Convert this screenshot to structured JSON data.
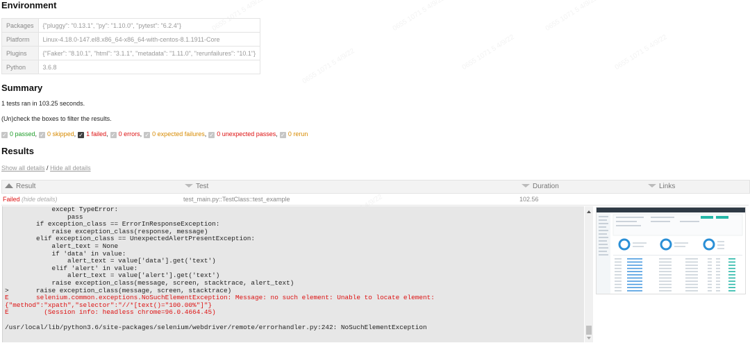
{
  "environment": {
    "heading": "Environment",
    "rows": [
      {
        "key": "Packages",
        "value": "{\"pluggy\": \"0.13.1\", \"py\": \"1.10.0\", \"pytest\": \"6.2.4\"}"
      },
      {
        "key": "Platform",
        "value": "Linux-4.18.0-147.el8.x86_64-x86_64-with-centos-8.1.1911-Core"
      },
      {
        "key": "Plugins",
        "value": "{\"Faker\": \"8.10.1\", \"html\": \"3.1.1\", \"metadata\": \"1.11.0\", \"rerunfailures\": \"10.1\"}"
      },
      {
        "key": "Python",
        "value": "3.6.8"
      }
    ]
  },
  "summary": {
    "heading": "Summary",
    "ran_text": "1 tests ran in 103.25 seconds.",
    "filter_hint": "(Un)check the boxes to filter the results.",
    "filters": [
      {
        "label": "0 passed",
        "checked": false
      },
      {
        "label": "0 skipped",
        "checked": false
      },
      {
        "label": "1 failed",
        "checked": true
      },
      {
        "label": "0 errors",
        "checked": false
      },
      {
        "label": "0 expected failures",
        "checked": false
      },
      {
        "label": "0 unexpected passes",
        "checked": false
      },
      {
        "label": "0 rerun",
        "checked": false
      }
    ]
  },
  "results": {
    "heading": "Results",
    "show_all": "Show all details",
    "divider": " / ",
    "hide_all": "Hide all details",
    "columns": {
      "result": "Result",
      "test": "Test",
      "duration": "Duration",
      "links": "Links"
    },
    "row": {
      "result": "Failed",
      "hide_details": "(hide details)",
      "test": "test_main.py::TestClass::test_example",
      "duration": "102.56",
      "links": ""
    }
  },
  "log": {
    "lines": [
      {
        "text": "            except TypeError:",
        "error": false
      },
      {
        "text": "                pass",
        "error": false
      },
      {
        "text": "        if exception_class == ErrorInResponseException:",
        "error": false
      },
      {
        "text": "            raise exception_class(response, message)",
        "error": false
      },
      {
        "text": "        elif exception_class == UnexpectedAlertPresentException:",
        "error": false
      },
      {
        "text": "            alert_text = None",
        "error": false
      },
      {
        "text": "            if 'data' in value:",
        "error": false
      },
      {
        "text": "                alert_text = value['data'].get('text')",
        "error": false
      },
      {
        "text": "            elif 'alert' in value:",
        "error": false
      },
      {
        "text": "                alert_text = value['alert'].get('text')",
        "error": false
      },
      {
        "text": "            raise exception_class(message, screen, stacktrace, alert_text)",
        "error": false
      },
      {
        "text": ">       raise exception_class(message, screen, stacktrace)",
        "error": false
      },
      {
        "text": "E       selenium.common.exceptions.NoSuchElementException: Message: no such element: Unable to locate element:",
        "error": true
      },
      {
        "text": "{\"method\":\"xpath\",\"selector\":\"//*[text()=\"100.00%\"]\"}",
        "error": true
      },
      {
        "text": "E         (Session info: headless chrome=96.0.4664.45)",
        "error": true
      },
      {
        "text": "",
        "error": false
      },
      {
        "text": "/usr/local/lib/python3.6/site-packages/selenium/webdriver/remote/errorhandler.py:242: NoSuchElementException",
        "error": false
      }
    ]
  },
  "colors": {
    "failed": "#dd1111",
    "passed": "#1f9d2a",
    "warn": "#d78a00",
    "log_bg": "#e7e7e7",
    "checkbox_on": "#404040",
    "checkbox_off": "#c6c6c6"
  }
}
